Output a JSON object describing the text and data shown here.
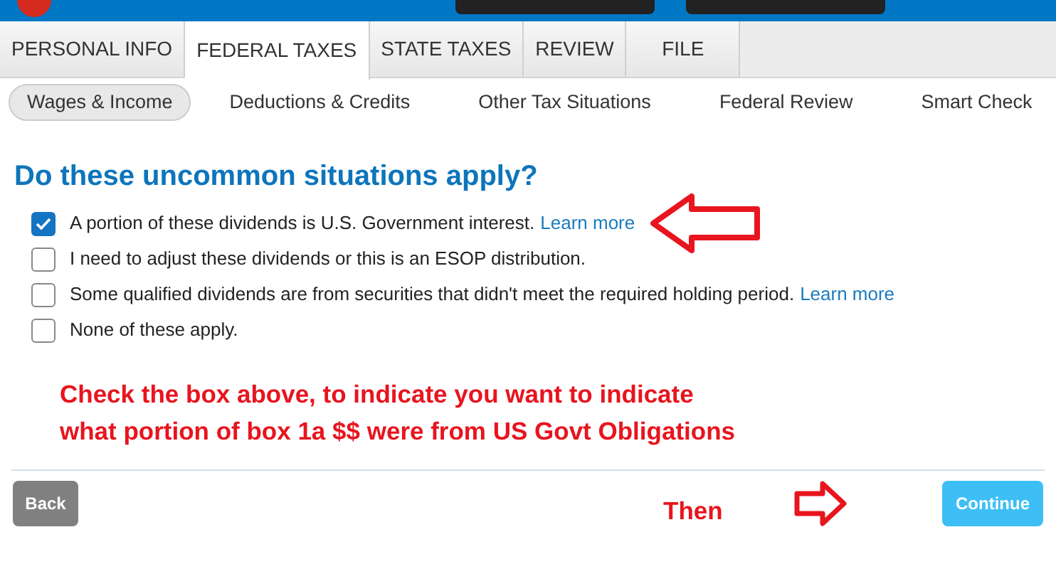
{
  "tabs": [
    {
      "label": "PERSONAL INFO",
      "selected": false
    },
    {
      "label": "FEDERAL TAXES",
      "selected": true
    },
    {
      "label": "STATE TAXES",
      "selected": false
    },
    {
      "label": "REVIEW",
      "selected": false
    },
    {
      "label": "FILE",
      "selected": false
    }
  ],
  "subnav": [
    {
      "label": "Wages & Income",
      "selected": true
    },
    {
      "label": "Deductions & Credits",
      "selected": false
    },
    {
      "label": "Other Tax Situations",
      "selected": false
    },
    {
      "label": "Federal Review",
      "selected": false
    },
    {
      "label": "Smart Check",
      "selected": false
    }
  ],
  "heading": "Do these uncommon situations apply?",
  "options": [
    {
      "label": "A portion of these dividends is U.S. Government interest.",
      "link": "Learn more",
      "checked": true
    },
    {
      "label": "I need to adjust these dividends or this is an ESOP distribution.",
      "checked": false
    },
    {
      "label": "Some qualified dividends are from securities that didn't meet the required holding period.",
      "link": "Learn more",
      "checked": false
    },
    {
      "label": "None of these apply.",
      "checked": false
    }
  ],
  "annotation": [
    "Check the box above, to indicate you want to indicate",
    "what portion of box 1a $$ were from US Govt Obligations"
  ],
  "then_label": "Then",
  "buttons": {
    "back": "Back",
    "continue": "Continue"
  }
}
